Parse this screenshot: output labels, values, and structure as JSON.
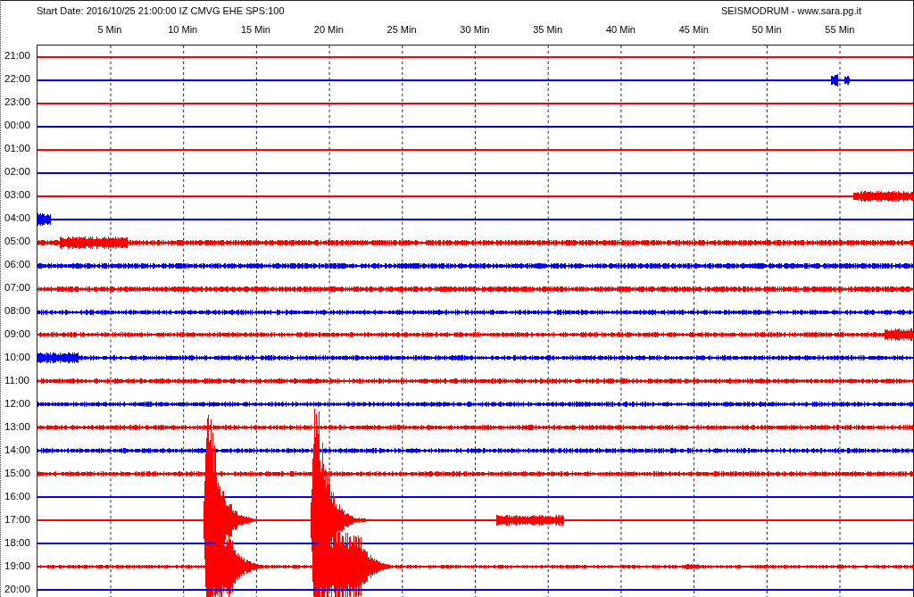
{
  "header": {
    "title": "Start Date: 2016/10/25 21:00:00 IZ CMVG EHE SPS:100",
    "brand": "SEISMODRUM - www.sara.pg.it"
  },
  "minute_labels": [
    "5 Min",
    "10 Min",
    "15 Min",
    "20 Min",
    "25 Min",
    "30 Min",
    "35 Min",
    "40 Min",
    "45 Min",
    "50 Min",
    "55 Min"
  ],
  "traces": [
    {
      "hour": "21:00",
      "color": "#ff0000"
    },
    {
      "hour": "22:00",
      "color": "#0000ff"
    },
    {
      "hour": "23:00",
      "color": "#ff0000"
    },
    {
      "hour": "00:00",
      "color": "#0000ff"
    },
    {
      "hour": "01:00",
      "color": "#ff0000"
    },
    {
      "hour": "02:00",
      "color": "#0000ff"
    },
    {
      "hour": "03:00",
      "color": "#ff0000"
    },
    {
      "hour": "04:00",
      "color": "#0000ff"
    },
    {
      "hour": "05:00",
      "color": "#ff0000"
    },
    {
      "hour": "06:00",
      "color": "#0000ff"
    },
    {
      "hour": "07:00",
      "color": "#ff0000"
    },
    {
      "hour": "08:00",
      "color": "#0000ff"
    },
    {
      "hour": "09:00",
      "color": "#ff0000"
    },
    {
      "hour": "10:00",
      "color": "#0000ff"
    },
    {
      "hour": "11:00",
      "color": "#ff0000"
    },
    {
      "hour": "12:00",
      "color": "#0000ff"
    },
    {
      "hour": "13:00",
      "color": "#ff0000"
    },
    {
      "hour": "14:00",
      "color": "#0000ff"
    },
    {
      "hour": "15:00",
      "color": "#ff0000"
    },
    {
      "hour": "16:00",
      "color": "#0000ff"
    },
    {
      "hour": "17:00",
      "color": "#ff0000"
    },
    {
      "hour": "18:00",
      "color": "#0000ff"
    },
    {
      "hour": "19:00",
      "color": "#ff0000"
    },
    {
      "hour": "20:00",
      "color": "#0000ff"
    }
  ]
}
